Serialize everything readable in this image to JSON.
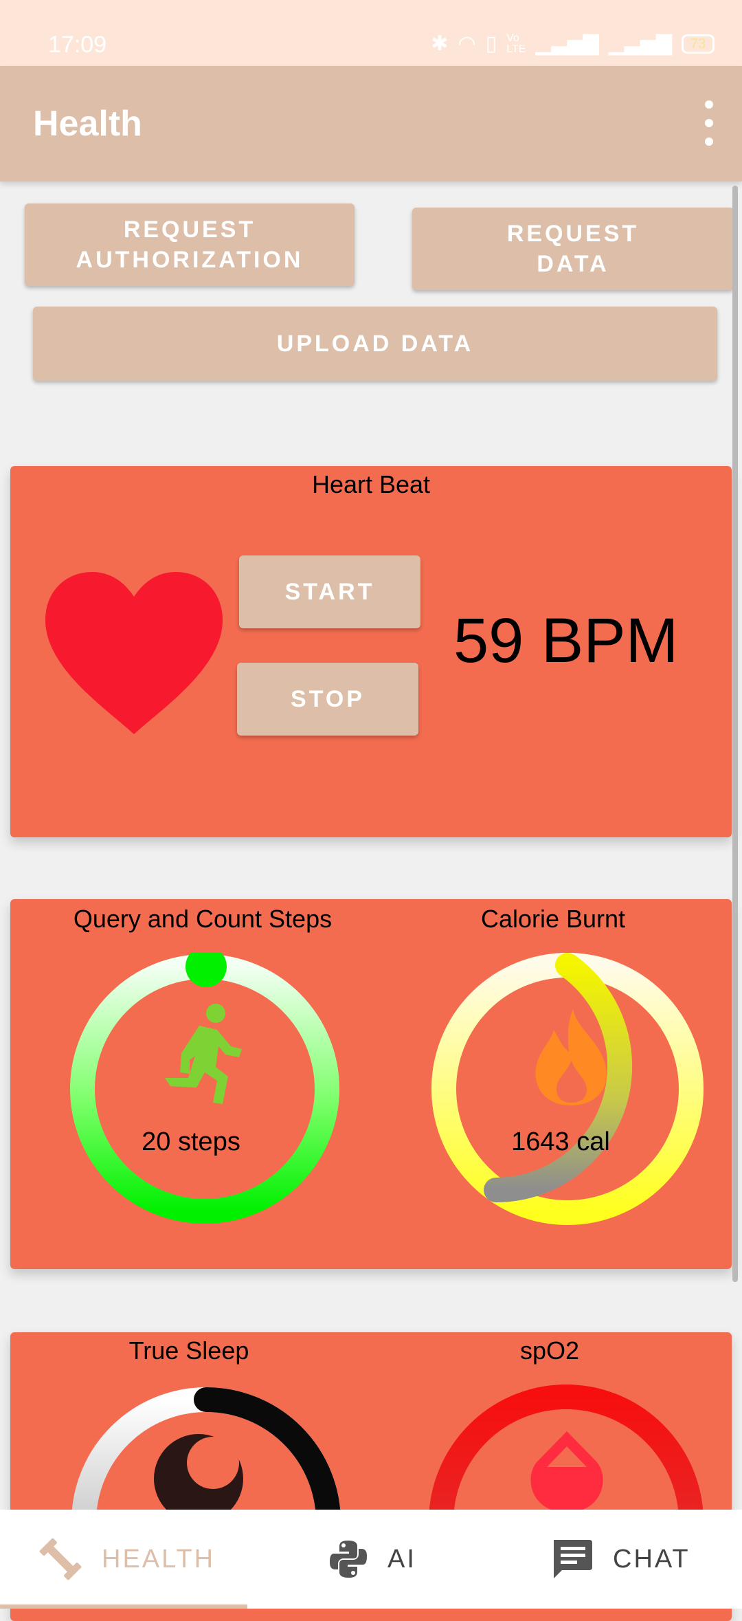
{
  "status_bar": {
    "time": "17:09",
    "battery": "73",
    "icons": [
      "bluetooth-icon",
      "headphones-icon",
      "vibrate-icon",
      "volte-icon",
      "signal-icon",
      "signal-icon-2"
    ]
  },
  "app_bar": {
    "title": "Health"
  },
  "buttons": {
    "request_authorization": "REQUEST AUTHORIZATION",
    "request_data": "REQUEST DATA",
    "upload_data": "UPLOAD DATA"
  },
  "heart_card": {
    "title": "Heart Beat",
    "start": "START",
    "stop": "STOP",
    "bpm": "59 BPM"
  },
  "steps_card": {
    "title": "Query and Count Steps",
    "value": "20 steps",
    "progress": 0.0
  },
  "calorie_card": {
    "title": "Calorie Burnt",
    "value": "1643 cal"
  },
  "sleep_card": {
    "title": "True Sleep"
  },
  "spo2_card": {
    "title": "spO2"
  },
  "bottom_nav": {
    "items": [
      {
        "label": "HEALTH",
        "icon": "dumbbell-icon",
        "active": true
      },
      {
        "label": "AI",
        "icon": "python-icon",
        "active": false
      },
      {
        "label": "CHAT",
        "icon": "chat-icon",
        "active": false
      }
    ]
  },
  "colors": {
    "accent": "#ddbfa9",
    "card": "#f46c50",
    "heart": "#f7192d"
  }
}
